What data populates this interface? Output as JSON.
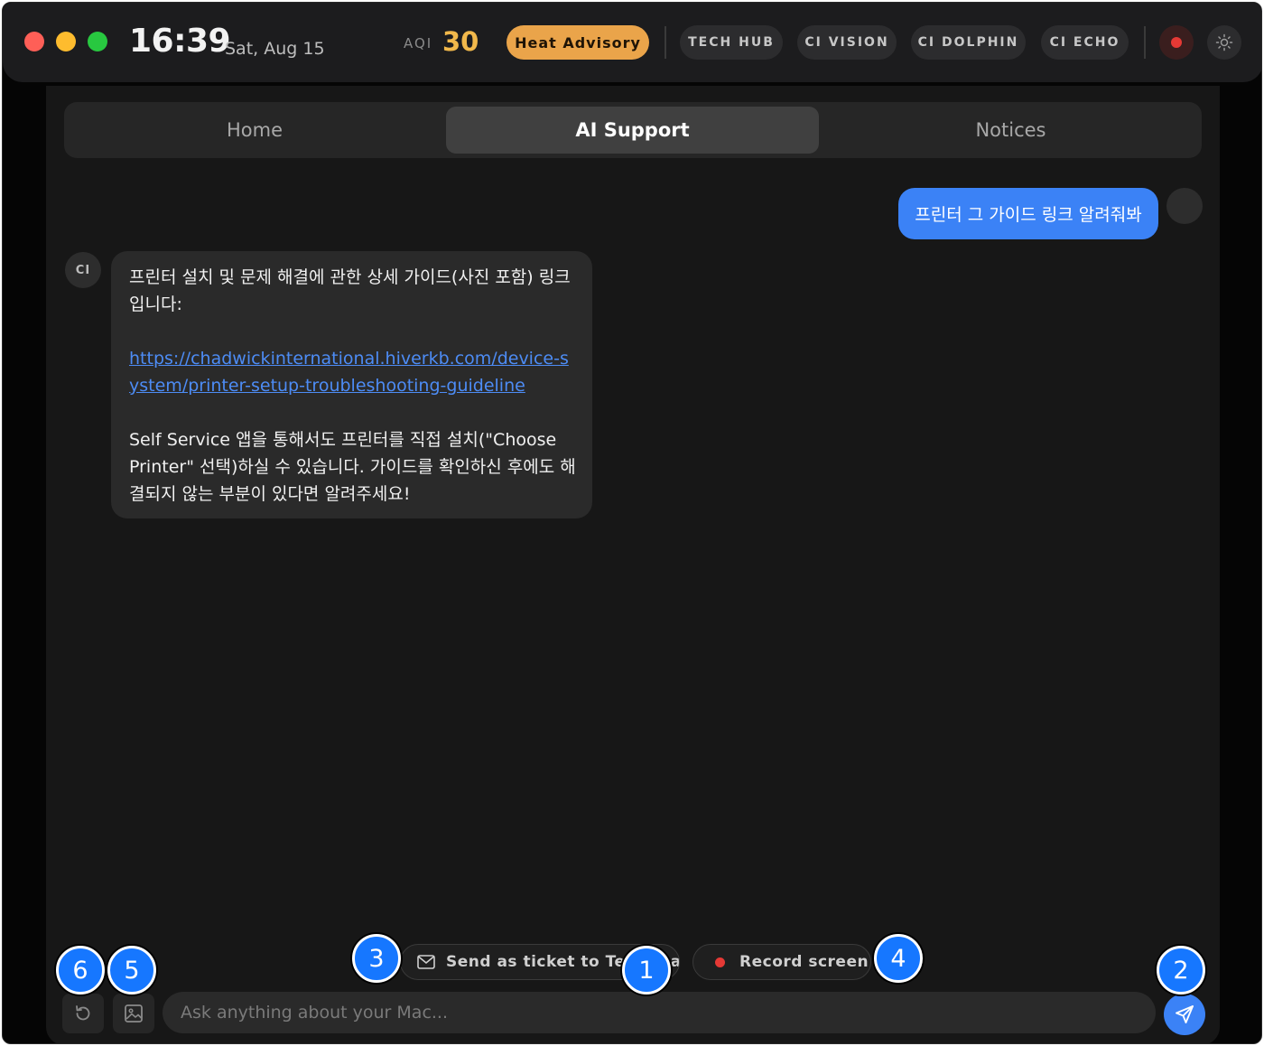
{
  "topbar": {
    "time": "16:39",
    "date": "Sat, Aug 15",
    "aqi_label": "AQI",
    "aqi_value": "30",
    "advisory": "Heat Advisory",
    "nav": [
      "TECH HUB",
      "CI VISION",
      "CI DOLPHIN",
      "CI ECHO"
    ],
    "icons": {
      "record": "record-dot-icon",
      "theme": "sun-icon"
    },
    "colors": {
      "advisory": "#eaa44a",
      "aqi": "#f1b84b",
      "record": "#e53935"
    }
  },
  "tabs": [
    {
      "label": "Home",
      "active": false
    },
    {
      "label": "AI Support",
      "active": true
    },
    {
      "label": "Notices",
      "active": false
    }
  ],
  "chat": {
    "user_message": "프린터 그 가이드 링크 알려줘봐",
    "assistant_avatar": "CI",
    "assistant": {
      "intro": "프린터 설치 및 문제 해결에 관한 상세 가이드(사진 포함) 링크입니다:",
      "link": "https://chadwickinternational.hiverkb.com/device-system/printer-setup-troubleshooting-guideline",
      "outro": "Self Service 앱을 통해서도 프린터를 직접 설치(\"Choose Printer\" 선택)하실 수 있습니다. 가이드를 확인하신 후에도 해결되지 않는 부분이 있다면 알려주세요!"
    }
  },
  "composer": {
    "ticket_chip": "Send as ticket to Tech team",
    "record_chip": "Record screen",
    "placeholder": "Ask anything about your Mac...",
    "icons": {
      "reset": "reset-icon",
      "image": "image-icon",
      "send": "send-icon",
      "mail": "mail-icon"
    },
    "accent": "#3b82f6"
  },
  "markers": [
    "1",
    "2",
    "3",
    "4",
    "5",
    "6"
  ]
}
